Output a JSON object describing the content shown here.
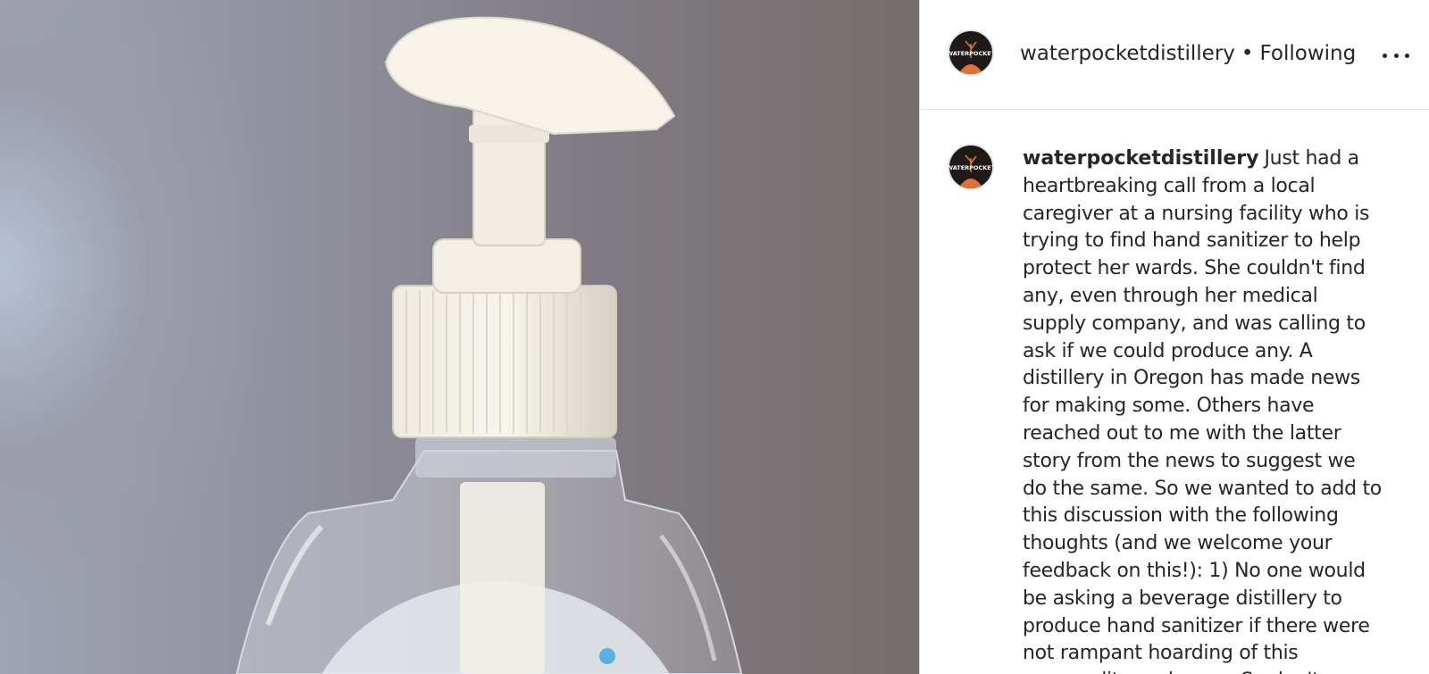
{
  "post": {
    "media_alt_icon": "hand-sanitizer-pump-bottle-photo"
  },
  "header": {
    "username": "waterpocketdistillery",
    "separator": "•",
    "follow_status": "Following",
    "avatar_text": "WATERPOCKET",
    "more_icon": "more-horizontal-icon"
  },
  "caption": {
    "username": "waterpocketdistillery",
    "avatar_text": "WATERPOCKET",
    "text": "Just had a heartbreaking call from a local caregiver at a nursing facility who is trying to find hand sanitizer to help protect her wards. She couldn't find any, even through her medical supply company, and was calling to ask if we could produce any. A distillery in Oregon has made news for making some. Others have reached out to me with the latter story from the news to suggest we do the same. So we wanted to add to this discussion with the following thoughts (and we welcome your feedback on this!): 1) No one would be asking a beverage distillery to produce hand sanitizer if there were not rampant hoarding of this commodity underway. So don't"
  },
  "colors": {
    "text": "#262626",
    "divider": "#dbdbdb",
    "avatar_accent": "#e0703a"
  }
}
